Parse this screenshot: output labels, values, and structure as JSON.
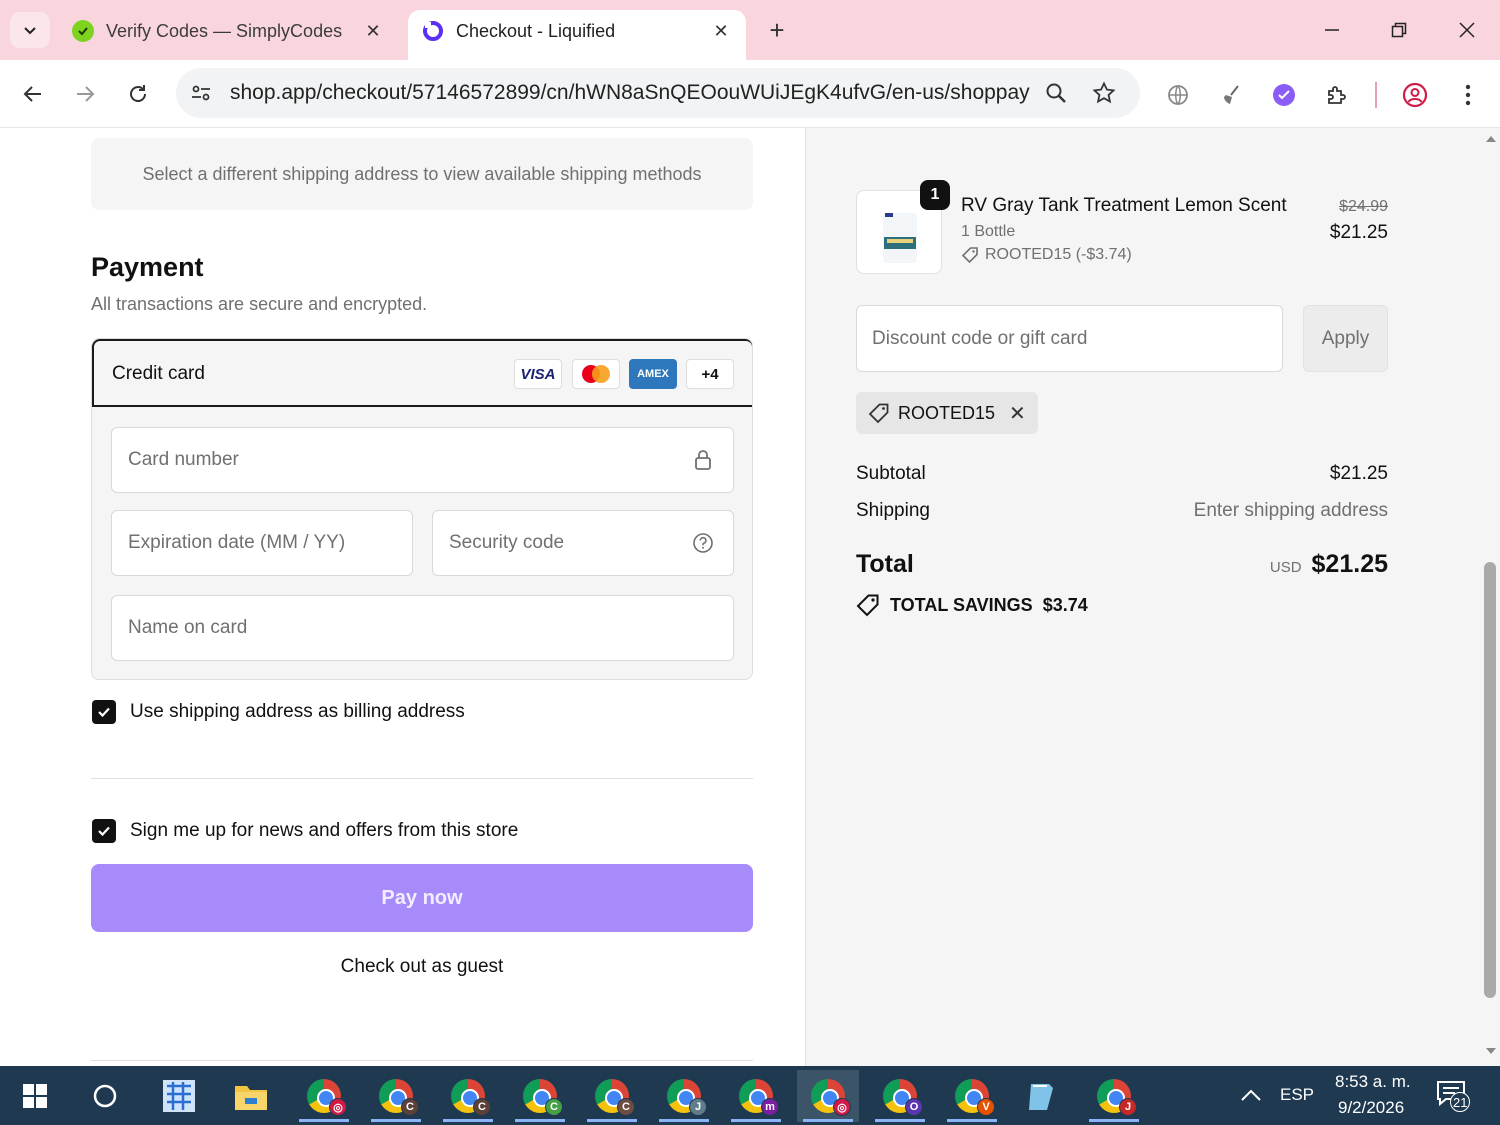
{
  "browser": {
    "tabs": [
      {
        "title": "Verify Codes — SimplyCodes",
        "favicon": "simplycodes-icon",
        "active": false
      },
      {
        "title": "Checkout - Liquified",
        "favicon": "shop-icon",
        "active": true
      }
    ],
    "url": "shop.app/checkout/57146572899/cn/hWN8aSnQEOouWUiJEgK4ufvG/en-us/shoppay?..."
  },
  "checkout": {
    "shipping_notice": "Select a different shipping address to view available shipping methods",
    "payment": {
      "title": "Payment",
      "subtitle": "All transactions are secure and encrypted.",
      "method_label": "Credit card",
      "brands": [
        "VISA",
        "mastercard",
        "AMEX",
        "+4"
      ],
      "card_number_placeholder": "Card number",
      "expiry_placeholder": "Expiration date (MM / YY)",
      "security_placeholder": "Security code",
      "name_placeholder": "Name on card"
    },
    "billing_checkbox": "Use shipping address as billing address",
    "newsletter_checkbox": "Sign me up for news and offers from this store",
    "pay_button": "Pay now",
    "guest_link": "Check out as guest"
  },
  "summary": {
    "product": {
      "quantity": "1",
      "name": "RV Gray Tank Treatment Lemon Scent",
      "variant": "1 Bottle",
      "discount": "ROOTED15 (-$3.74)",
      "original_price": "$24.99",
      "price": "$21.25"
    },
    "discount_placeholder": "Discount code or gift card",
    "apply_label": "Apply",
    "applied_code": "ROOTED15",
    "subtotal_label": "Subtotal",
    "subtotal_value": "$21.25",
    "shipping_label": "Shipping",
    "shipping_value": "Enter shipping address",
    "total_label": "Total",
    "currency": "USD",
    "total_value": "$21.25",
    "savings_label": "TOTAL SAVINGS",
    "savings_value": "$3.74"
  },
  "taskbar": {
    "badges": [
      "C",
      "C",
      "C",
      "C",
      "J",
      "m",
      "",
      "O",
      "V",
      "J"
    ],
    "language": "ESP",
    "time": "8:53 a. m.",
    "date": "9/2/2026",
    "notifications": "21"
  },
  "colors": {
    "tabstrip": "#f9d6dd",
    "pay_button": "#a78bfa",
    "summary_bg": "#f5f5f5",
    "taskbar": "#1f3a50"
  }
}
